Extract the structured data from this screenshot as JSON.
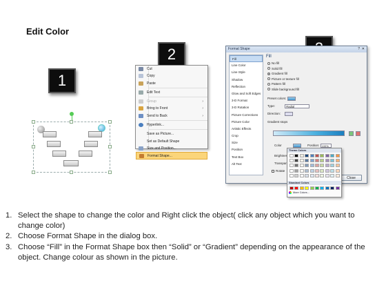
{
  "title": "Edit Color",
  "steps": {
    "one": "1",
    "two": "2",
    "three": "3"
  },
  "context_menu": {
    "items": [
      "Cut",
      "Copy",
      "Paste",
      "Edit Text",
      "Group",
      "Bring to Front",
      "Send to Back",
      "Hyperlink...",
      "Save as Picture...",
      "Set as Default Shape",
      "Size and Position...",
      "Format Shape..."
    ]
  },
  "format_shape": {
    "title": "Format Shape",
    "categories": [
      "Fill",
      "Line Color",
      "Line Style",
      "Shadow",
      "Reflection",
      "Glow and Soft Edges",
      "3-D Format",
      "3-D Rotation",
      "Picture Corrections",
      "Picture Color",
      "Artistic Effects",
      "Crop",
      "Size",
      "Position",
      "Text Box",
      "Alt Text"
    ],
    "fill_title": "Fill",
    "fill_options": [
      "No fill",
      "Solid fill",
      "Gradient fill",
      "Picture or texture fill",
      "Pattern fill",
      "Slide background fill"
    ],
    "preset_colors": "Preset colors:",
    "type": "Type:",
    "type_value": "Radial",
    "direction": "Direction:",
    "gradient_stops": "Gradient stops",
    "color": "Color",
    "position": "Position:",
    "position_value": "100%",
    "brightness": "Brightness",
    "transparency": "Transparency",
    "rotate": "Rotate",
    "close": "Close"
  },
  "palette": {
    "theme_colors": "Theme Colors",
    "standard_colors": "Standard Colors",
    "more_colors": "More Colors..."
  },
  "instructions": [
    {
      "num": "1.",
      "text": "Select the shape to change the color and Right click the object( click any object which you want to change color)"
    },
    {
      "num": "2.",
      "text": "Choose Format Shape in the dialog box."
    },
    {
      "num": "3.",
      "text": "Choose “Fill” in the Format Shape box then “Solid” or “Gradient” depending on the appearance of the object. Change colour as shown in the picture."
    }
  ],
  "colors": {
    "accent_highlight": "#fbd57a",
    "badge": "#0d0d0d",
    "gradient_blue": "#4ab0df"
  }
}
